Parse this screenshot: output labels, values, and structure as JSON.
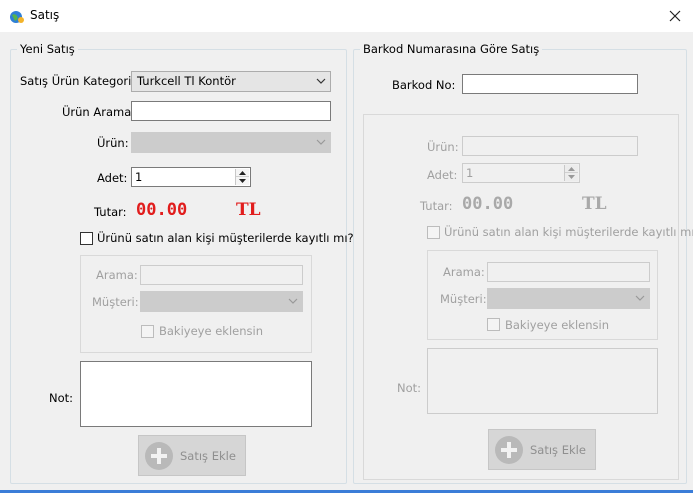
{
  "window": {
    "title": "Satış",
    "icon": "globe-app-icon",
    "close_icon": "close-icon"
  },
  "left_group": {
    "legend": "Yeni Satış",
    "category_label": "Satış Ürün Kategorisi:",
    "category_value": "Turkcell Tl Kontör",
    "search_label": "Ürün Arama:",
    "search_value": "",
    "product_label": "Ürün:",
    "product_value": "",
    "quantity_label": "Adet:",
    "quantity_value": "1",
    "total_label": "Tutar:",
    "total_value": "00.00",
    "currency": "TL",
    "registered_checkbox_label": "Ürünü satın alan kişi müşterilerde kayıtlı mı?",
    "registered_checked": false,
    "customer_panel": {
      "search_label": "Arama:",
      "customer_label": "Müşteri:",
      "balance_checkbox_label": "Bakiyeye eklensin"
    },
    "note_label": "Not:",
    "note_value": "",
    "add_button_label": "Satış Ekle"
  },
  "right_group": {
    "legend": "Barkod Numarasına Göre Satış",
    "barcode_label": "Barkod No:",
    "barcode_value": "",
    "product_label": "Ürün:",
    "quantity_label": "Adet:",
    "quantity_value": "1",
    "total_label": "Tutar:",
    "total_value": "00.00",
    "currency": "TL",
    "registered_checkbox_label": "Ürünü satın alan kişi müşterilerde kayıtlı mı?",
    "customer_panel": {
      "search_label": "Arama:",
      "customer_label": "Müşteri:",
      "balance_checkbox_label": "Bakiyeye eklensin"
    },
    "note_label": "Not:",
    "add_button_label": "Satış Ekle"
  },
  "colors": {
    "total_red": "#e11d1d",
    "disabled_text": "#a0a0a0",
    "accent_bottom": "#3b7dd8"
  }
}
